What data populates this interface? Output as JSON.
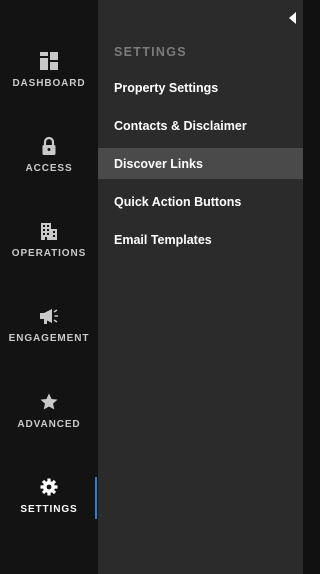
{
  "nav": {
    "items": [
      {
        "label": "DASHBOARD",
        "icon": "dashboard-icon"
      },
      {
        "label": "ACCESS",
        "icon": "lock-icon"
      },
      {
        "label": "OPERATIONS",
        "icon": "building-icon"
      },
      {
        "label": "ENGAGEMENT",
        "icon": "megaphone-icon"
      },
      {
        "label": "ADVANCED",
        "icon": "star-icon"
      },
      {
        "label": "SETTINGS",
        "icon": "gear-icon"
      }
    ],
    "active": "SETTINGS"
  },
  "submenu": {
    "title": "SETTINGS",
    "items": [
      "Property Settings",
      "Contacts & Disclaimer",
      "Discover Links",
      "Quick Action Buttons",
      "Email Templates"
    ],
    "active": "Discover Links"
  },
  "colors": {
    "rail_bg": "#131313",
    "panel_bg": "#2b2b2b",
    "active_item_bg": "#4a4a4a",
    "active_indicator": "#2e7fd1",
    "section_title": "#7c7c7c"
  }
}
